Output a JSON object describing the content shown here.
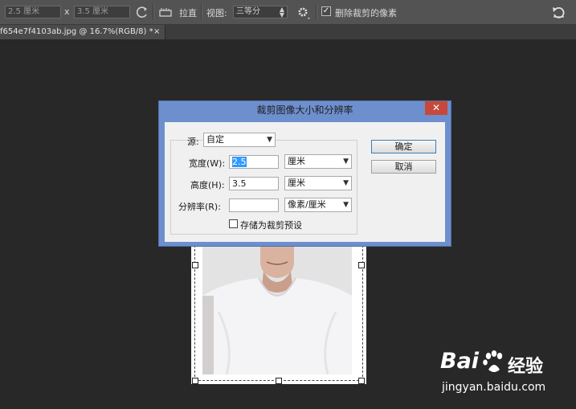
{
  "options_bar": {
    "width_value": "2.5 厘米",
    "separator_x": "x",
    "height_value": "3.5 厘米",
    "straighten_label": "拉直",
    "view_label": "视图:",
    "view_value": "三等分",
    "delete_cropped_label": "删除裁剪的像素",
    "delete_cropped_checked": true
  },
  "document_tab": {
    "title": "f654e7f4103ab.jpg @ 16.7%(RGB/8) *",
    "close": "×"
  },
  "dialog": {
    "title": "裁剪图像大小和分辨率",
    "close": "✕",
    "source_label": "源:",
    "source_value": "自定",
    "width_label": "宽度(W):",
    "width_value": "2.5",
    "width_unit": "厘米",
    "height_label": "高度(H):",
    "height_value": "3.5",
    "height_unit": "厘米",
    "resolution_label": "分辨率(R):",
    "resolution_value": "",
    "resolution_unit": "像素/厘米",
    "save_preset_label": "存储为裁剪预设",
    "save_preset_checked": false,
    "ok_label": "确定",
    "cancel_label": "取消"
  },
  "watermark": {
    "brand_left": "Bai",
    "brand_right": "经验",
    "url": "jingyan.baidu.com"
  },
  "colors": {
    "workspace_bg": "#282828",
    "options_bar_bg": "#535353",
    "dialog_frame": "#6d8fcd",
    "dialog_close": "#c7483a",
    "selection_highlight": "#3399ff"
  }
}
